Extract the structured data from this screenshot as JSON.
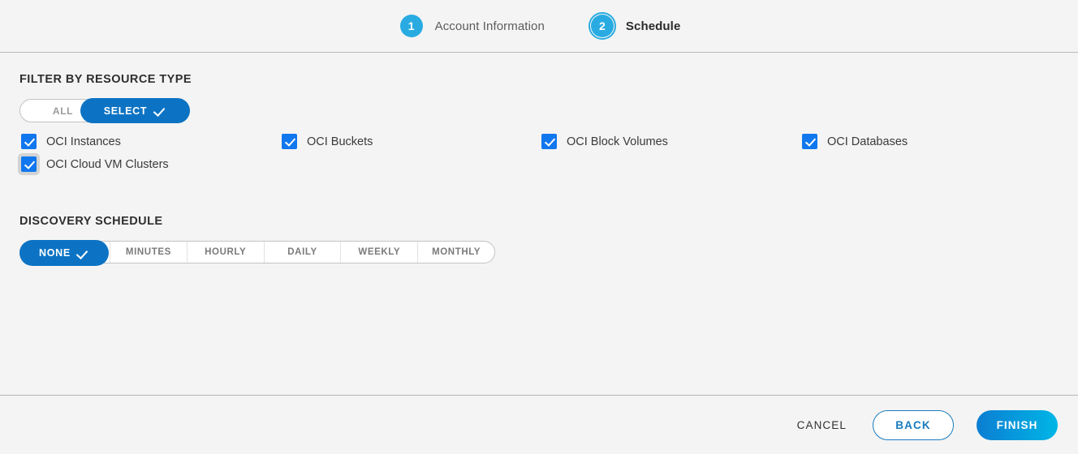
{
  "stepper": {
    "steps": [
      {
        "number": "1",
        "label": "Account Information",
        "active": false
      },
      {
        "number": "2",
        "label": "Schedule",
        "active": true
      }
    ]
  },
  "filter_section": {
    "title": "FILTER BY RESOURCE TYPE",
    "toggle": {
      "all_label": "ALL",
      "select_label": "SELECT",
      "selected": "SELECT"
    },
    "resources": [
      {
        "label": "OCI Instances",
        "checked": true
      },
      {
        "label": "OCI Buckets",
        "checked": true
      },
      {
        "label": "OCI Block Volumes",
        "checked": true
      },
      {
        "label": "OCI Databases",
        "checked": true
      },
      {
        "label": "OCI Cloud VM Clusters",
        "checked": true
      }
    ]
  },
  "schedule_section": {
    "title": "DISCOVERY SCHEDULE",
    "options": [
      "NONE",
      "MINUTES",
      "HOURLY",
      "DAILY",
      "WEEKLY",
      "MONTHLY"
    ],
    "selected": "NONE"
  },
  "footer": {
    "cancel_label": "CANCEL",
    "back_label": "BACK",
    "finish_label": "FINISH"
  },
  "colors": {
    "accent_blue": "#0c73c4",
    "step_blue": "#29abe2",
    "checkbox_blue": "#1177ee",
    "finish_gradient_start": "#0b7ed2",
    "finish_gradient_end": "#00b6e6",
    "background": "#f4f4f4"
  }
}
